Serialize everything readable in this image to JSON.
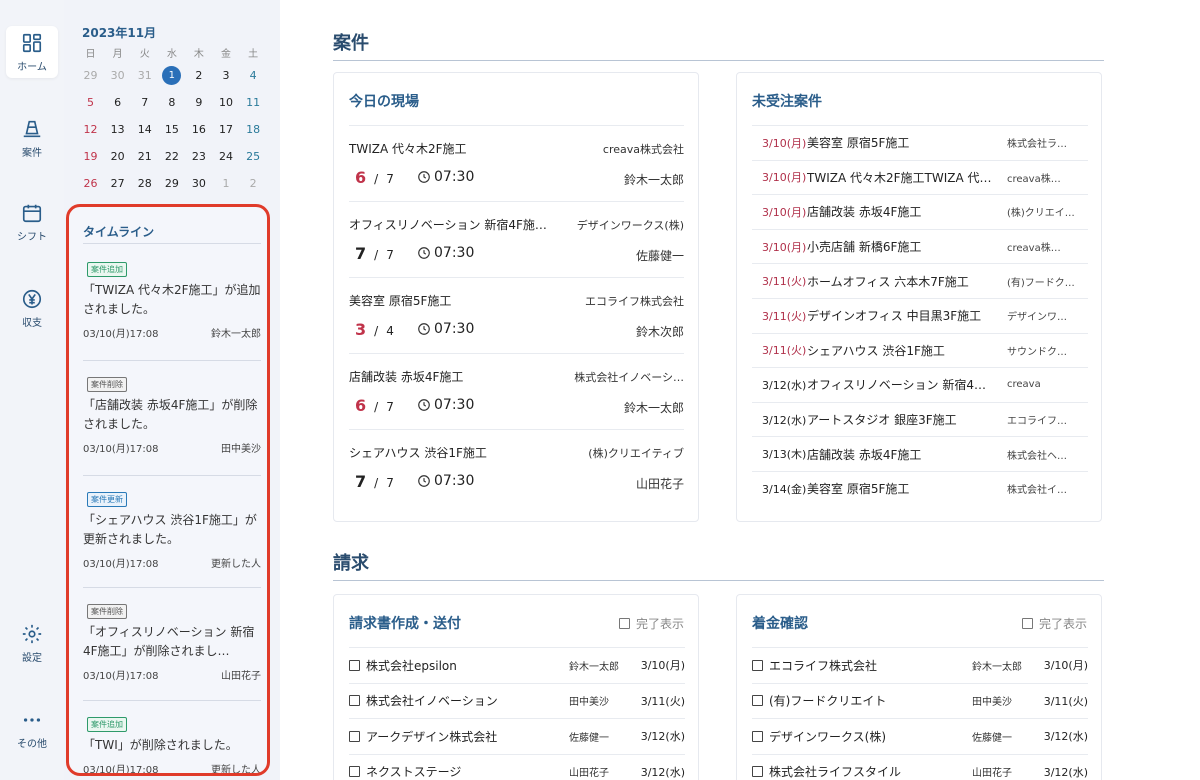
{
  "nav": {
    "items": [
      {
        "label": "ホーム",
        "icon": "dashboard-icon"
      },
      {
        "label": "案件",
        "icon": "cone-icon"
      },
      {
        "label": "シフト",
        "icon": "calendar-icon"
      },
      {
        "label": "収支",
        "icon": "yen-icon"
      },
      {
        "label": "設定",
        "icon": "gear-icon"
      },
      {
        "label": "その他",
        "icon": "more-icon"
      }
    ]
  },
  "calendar": {
    "title": "2023年11月",
    "weekdays": [
      "日",
      "月",
      "火",
      "水",
      "木",
      "金",
      "土"
    ],
    "weeks": [
      [
        "29",
        "30",
        "31",
        "1",
        "2",
        "3",
        "4"
      ],
      [
        "5",
        "6",
        "7",
        "8",
        "9",
        "10",
        "11"
      ],
      [
        "12",
        "13",
        "14",
        "15",
        "16",
        "17",
        "18"
      ],
      [
        "19",
        "20",
        "21",
        "22",
        "23",
        "24",
        "25"
      ],
      [
        "26",
        "27",
        "28",
        "29",
        "30",
        "1",
        "2"
      ]
    ],
    "today": "1"
  },
  "timeline": {
    "title": "タイムライン",
    "items": [
      {
        "badge": "案件追加",
        "type": "add",
        "text": "「TWIZA 代々木2F施工」が追加されました。",
        "time": "03/10(月)17:08",
        "user": "鈴木一太郎"
      },
      {
        "badge": "案件削除",
        "type": "del",
        "text": "「店舗改装 赤坂4F施工」が削除されました。",
        "time": "03/10(月)17:08",
        "user": "田中美沙"
      },
      {
        "badge": "案件更新",
        "type": "upd",
        "text": "「シェアハウス 渋谷1F施工」が更新されました。",
        "time": "03/10(月)17:08",
        "user": "更新した人"
      },
      {
        "badge": "案件削除",
        "type": "del",
        "text": "「オフィスリノベーション 新宿4F施工」が削除されまし…",
        "time": "03/10(月)17:08",
        "user": "山田花子"
      },
      {
        "badge": "案件追加",
        "type": "add",
        "text": "「TWI」が削除されました。",
        "time": "03/10(月)17:08",
        "user": "更新した人"
      }
    ]
  },
  "projects": {
    "section_title": "案件",
    "today_sites": {
      "title": "今日の現場",
      "rows": [
        {
          "name": "TWIZA 代々木2F施工",
          "client": "creava株式会社",
          "count": "6",
          "total": "7",
          "time": "07:30",
          "person": "鈴木一太郎",
          "alert": true
        },
        {
          "name": "オフィスリノベーション 新宿4F施…",
          "client": "デザインワークス(株)",
          "count": "7",
          "total": "7",
          "time": "07:30",
          "person": "佐藤健一",
          "alert": false
        },
        {
          "name": "美容室 原宿5F施工",
          "client": "エコライフ株式会社",
          "count": "3",
          "total": "4",
          "time": "07:30",
          "person": "鈴木次郎",
          "alert": true
        },
        {
          "name": "店舗改装 赤坂4F施工",
          "client": "株式会社イノベーシ…",
          "count": "6",
          "total": "7",
          "time": "07:30",
          "person": "鈴木一太郎",
          "alert": true
        },
        {
          "name": "シェアハウス 渋谷1F施工",
          "client": "(株)クリエイティブ",
          "count": "7",
          "total": "7",
          "time": "07:30",
          "person": "山田花子",
          "alert": false
        }
      ],
      "separator": "/"
    },
    "pending": {
      "title": "未受注案件",
      "rows": [
        {
          "date": "3/10(月)",
          "name": "美容室 原宿5F施工",
          "client": "株式会社ラ…",
          "red": true
        },
        {
          "date": "3/10(月)",
          "name": "TWIZA 代々木2F施工TWIZA 代…",
          "client": "creava株…",
          "red": true
        },
        {
          "date": "3/10(月)",
          "name": "店舗改装 赤坂4F施工",
          "client": "(株)クリエイ…",
          "red": true
        },
        {
          "date": "3/10(月)",
          "name": "小売店舗 新橋6F施工",
          "client": "creava株…",
          "red": true
        },
        {
          "date": "3/11(火)",
          "name": "ホームオフィス 六本木7F施工",
          "client": "(有)フードク…",
          "red": true
        },
        {
          "date": "3/11(火)",
          "name": "デザインオフィス 中目黒3F施工",
          "client": "デザインワ…",
          "red": true
        },
        {
          "date": "3/11(火)",
          "name": "シェアハウス 渋谷1F施工",
          "client": "サウンドク…",
          "red": true
        },
        {
          "date": "3/12(水)",
          "name": "オフィスリノベーション 新宿4…",
          "client": "creava",
          "red": false
        },
        {
          "date": "3/12(水)",
          "name": "アートスタジオ 銀座3F施工",
          "client": "エコライフ…",
          "red": false
        },
        {
          "date": "3/13(木)",
          "name": "店舗改装 赤坂4F施工",
          "client": "株式会社ヘ…",
          "red": false
        },
        {
          "date": "3/14(金)",
          "name": "美容室 原宿5F施工",
          "client": "株式会社イ…",
          "red": false
        }
      ]
    }
  },
  "billing": {
    "section_title": "請求",
    "invoices": {
      "title": "請求書作成・送付",
      "toggle_label": "完了表示",
      "rows": [
        {
          "name": "株式会社epsilon",
          "person": "鈴木一太郎",
          "date": "3/10(月)"
        },
        {
          "name": "株式会社イノベーション",
          "person": "田中美沙",
          "date": "3/11(火)"
        },
        {
          "name": "アークデザイン株式会社",
          "person": "佐藤健一",
          "date": "3/12(水)"
        },
        {
          "name": "ネクストステージ",
          "person": "山田花子",
          "date": "3/12(水)"
        }
      ]
    },
    "payments": {
      "title": "着金確認",
      "toggle_label": "完了表示",
      "rows": [
        {
          "name": "エコライフ株式会社",
          "person": "鈴木一太郎",
          "date": "3/10(月)"
        },
        {
          "name": "(有)フードクリエイト",
          "person": "田中美沙",
          "date": "3/11(火)"
        },
        {
          "name": "デザインワークス(株)",
          "person": "佐藤健一",
          "date": "3/12(水)"
        },
        {
          "name": "株式会社ライフスタイル",
          "person": "山田花子",
          "date": "3/12(水)"
        }
      ]
    }
  },
  "colors": {
    "accent": "#2a5d8a",
    "alert": "#c0334a",
    "highlight_border": "#e03b2a"
  }
}
